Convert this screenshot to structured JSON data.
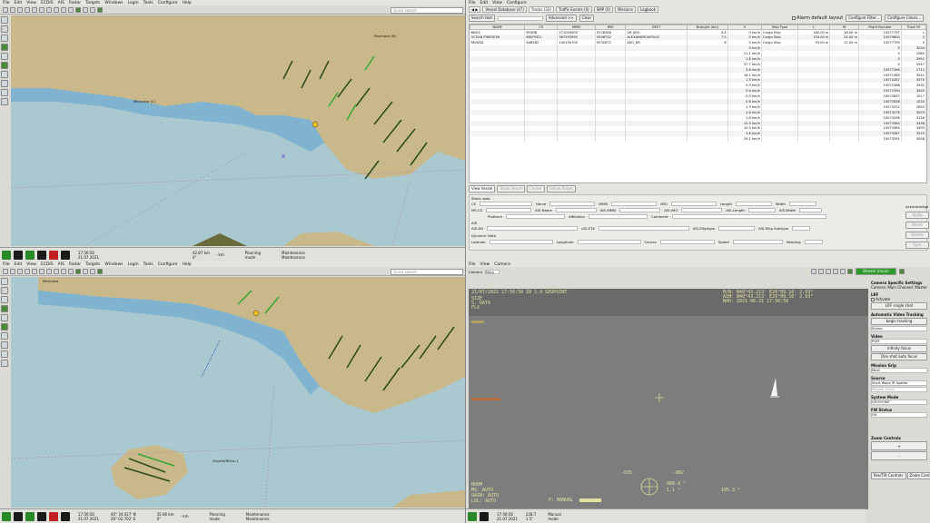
{
  "top_map": {
    "menu": [
      "File",
      "Edit",
      "View",
      "ECDIS",
      "AIS",
      "Radar",
      "Targets",
      "Windows",
      "Login",
      "Tools",
      "Configure",
      "Help"
    ],
    "search_placeholder": "Quick search",
    "labels": [
      "Mitrovica (C)",
      "Marmara (H)"
    ],
    "status": {
      "time": "17:56:56",
      "date": "21.07.2021",
      "range": "42.87 km",
      "pos": "0°",
      "dist": "- km",
      "mode1": "Planning",
      "mode1b": "mode",
      "mode2": "Maintenance",
      "mode2b": "Maintenance"
    }
  },
  "bottom_map": {
    "menu": [
      "File",
      "Edit",
      "View",
      "ECDIS",
      "AIS",
      "Radar",
      "Targets",
      "Windows",
      "Login",
      "Tools",
      "Configure",
      "Help"
    ],
    "search_placeholder": "Quick search",
    "labels": [
      "Mitrovica",
      "Zeyafe/Rhilis-1"
    ],
    "status": {
      "time": "17:56:56",
      "date": "21.07.2021",
      "lat": "40° 34.027' N",
      "lon": "26° 02.702' E",
      "range": "35.66 km",
      "pos": "0°",
      "dist": "- km",
      "mode1": "Planning",
      "mode1b": "mode",
      "mode2": "Maintenance",
      "mode2b": "Maintenance"
    }
  },
  "tracks": {
    "menu": [
      "File",
      "Edit",
      "View",
      "Configure"
    ],
    "tabs": [
      "Vessel Database (47)",
      "Tracks (33)",
      "Traffic Events (0)",
      "SMP (0)",
      "Missions",
      "Logbook"
    ],
    "search_button": "Search text",
    "advanced": "Advanced >>",
    "clear": "Clear",
    "alarm_default": "Alarm default layout",
    "configure_filter": "Configure Filter...",
    "configure_colors": "Configure Colors...",
    "columns": [
      "NAME",
      "CS",
      "MMSI",
      "IMO",
      "DEST",
      "Draught (dm)",
      "V",
      "Ship Type",
      "L",
      "W",
      "Flight Number",
      "Track ID"
    ],
    "rows": [
      [
        "BNOS",
        "SFQRB",
        "271050000",
        "9128288",
        "GR ARG",
        "4.4",
        "0 km/h",
        "Cargo Ship",
        "180.00 m",
        "18.00 m",
        "10077797",
        "1"
      ],
      [
        "OCEAN FREEDOM",
        "WDF9321",
        "367593990",
        "9506732",
        "ALEXANDROUPOLIS",
        "7.5",
        "0 km/h",
        "Cargo Ship",
        "154.00 m",
        "24.00 m",
        "10079800",
        "2"
      ],
      [
        "RENATA",
        "5AB582",
        "240190700",
        "9032872",
        "AXO_DR",
        "8",
        "0 km/h",
        "Cargo Ship",
        "93.00 m",
        "12.00 m",
        "10077799",
        "0"
      ],
      [
        "",
        "",
        "",
        "",
        "",
        "",
        "0 km/h",
        "",
        "",
        "",
        "0",
        "3034"
      ],
      [
        "",
        "",
        "",
        "",
        "",
        "",
        "11.1 km/h",
        "",
        "",
        "",
        "0",
        "2980"
      ],
      [
        "",
        "",
        "",
        "",
        "",
        "",
        "1.8 km/h",
        "",
        "",
        "",
        "0",
        "2992"
      ],
      [
        "",
        "",
        "",
        "",
        "",
        "",
        "37.7 km/h",
        "",
        "",
        "",
        "0",
        "2947"
      ],
      [
        "",
        "",
        "",
        "",
        "",
        "",
        "5.8 km/h",
        "",
        "",
        "",
        "10077266",
        "2712"
      ],
      [
        "",
        "",
        "",
        "",
        "",
        "",
        "16.1 km/h",
        "",
        "",
        "",
        "10071389",
        "3541"
      ],
      [
        "",
        "",
        "",
        "",
        "",
        "",
        "1.3 km/h",
        "",
        "",
        "",
        "10072287",
        "3070"
      ],
      [
        "",
        "",
        "",
        "",
        "",
        "",
        "0.9 km/h",
        "",
        "",
        "",
        "10072368",
        "3532"
      ],
      [
        "",
        "",
        "",
        "",
        "",
        "",
        "0.4 km/h",
        "",
        "",
        "",
        "10072390",
        "3045"
      ],
      [
        "",
        "",
        "",
        "",
        "",
        "",
        "0.0 km/h",
        "",
        "",
        "",
        "10072837",
        "1017"
      ],
      [
        "",
        "",
        "",
        "",
        "",
        "",
        "0.6 km/h",
        "",
        "",
        "",
        "10072838",
        "1033"
      ],
      [
        "",
        "",
        "",
        "",
        "",
        "",
        "1.3 km/h",
        "",
        "",
        "",
        "10073252",
        "2893"
      ],
      [
        "",
        "",
        "",
        "",
        "",
        "",
        "2.8 km/h",
        "",
        "",
        "",
        "10073276",
        "3023"
      ],
      [
        "",
        "",
        "",
        "",
        "",
        "",
        "1.8 km/h",
        "",
        "",
        "",
        "10073296",
        "3136"
      ],
      [
        "",
        "",
        "",
        "",
        "",
        "",
        "15.3 km/h",
        "",
        "",
        "",
        "10073364",
        "3436"
      ],
      [
        "",
        "",
        "",
        "",
        "",
        "",
        "10.5 km/h",
        "",
        "",
        "",
        "10073384",
        "3493"
      ],
      [
        "",
        "",
        "",
        "",
        "",
        "",
        "3.6 km/h",
        "",
        "",
        "",
        "10073387",
        "3525"
      ],
      [
        "",
        "",
        "",
        "",
        "",
        "",
        "29.1 km/h",
        "",
        "",
        "",
        "10073391",
        "3008"
      ]
    ],
    "detail_tabs": [
      "View Vessel",
      "Show Vessel",
      "Center",
      "Follow Target"
    ],
    "static_title": "Static data",
    "static_fields": [
      "CS",
      "Name",
      "MMSI",
      "IMO",
      "Length",
      "Width"
    ],
    "static_fields2": [
      "MS-CS",
      "AIS-Name",
      "AIS-MMSI",
      "AIS-IMO",
      "AIS-Length",
      "AIS-Width"
    ],
    "platform": "Platform",
    "affiliation": "Affiliation",
    "comment": "Comment",
    "ais": "AIS",
    "ais_fields": [
      "AIS-DH",
      "AIS-ETA",
      "AIS-Shiptype",
      "AIS-Ship-Subtype"
    ],
    "dynamic_title": "Dynamic Data",
    "dynamic_fields": [
      "Latitude",
      "Longitude",
      "Course",
      "Speed",
      "Heading"
    ],
    "acknowledge": "Acknowledge",
    "side_buttons": [
      "Apply",
      "Reset",
      "Delete",
      "Sync"
    ]
  },
  "camera": {
    "menu": [
      "File",
      "View",
      "Camera"
    ],
    "camera_label": "Camera",
    "camera_value": "Main",
    "stream_button": "Stream (main)",
    "osd_top": [
      "21/07/2021 17:56:56  IR 1.4  GEOPOINT",
      "M/N: N40°43.213' E26°09.16' 2.93°",
      "AIM: N40°43.213' E26°09.16' 2.93°",
      "N40: 2021-06-21 17:56:56"
    ],
    "osd_left": [
      "SIZE",
      "S. DATA",
      "FLX"
    ],
    "osd_bottom_left": [
      "NORM",
      "MS: AUTO",
      "GAIN: AUTO",
      "LVL: AUTO"
    ],
    "osd_compass": [
      "-035",
      "-002",
      "080.4 °",
      "1.1 °",
      "195.3 °"
    ],
    "manual": "P: MANUAL",
    "status": {
      "time": "17:56:56",
      "date": "21.07.2021",
      "size": "228.7",
      "zoom": "1.5°",
      "mode": "Manual",
      "modeb": "mode"
    }
  },
  "cam_side": {
    "title": "Camera Specific Settings",
    "camera": "Camera: Main",
    "channel": "Channel: Master",
    "lrf": "LRF",
    "activate": "Activate",
    "lrf_single": "LRF single shot",
    "auto_title": "Automatic Video Tracking",
    "begin": "begin tracking",
    "scene": "Scene",
    "video": "Video",
    "pgm": "PGM",
    "infinity": "Infinity focus",
    "one_shot": "One shot auto focus",
    "mission": "Mission Grip",
    "main": "Main",
    "source": "Source",
    "source_val": "Short Wave IR Spotter",
    "source_val2": "Magnet Zoom",
    "sysmode": "System Mode",
    "sysmode_val": "GEOPOINT",
    "fw": "FW Status",
    "fw_val": "OK",
    "zoom": "Zoom Controls",
    "zoom_plus": "+",
    "zoom_minus": "-",
    "pan_tilt": "Pan/Tilt Controls",
    "zoom_controls": "Zoom Controls"
  }
}
